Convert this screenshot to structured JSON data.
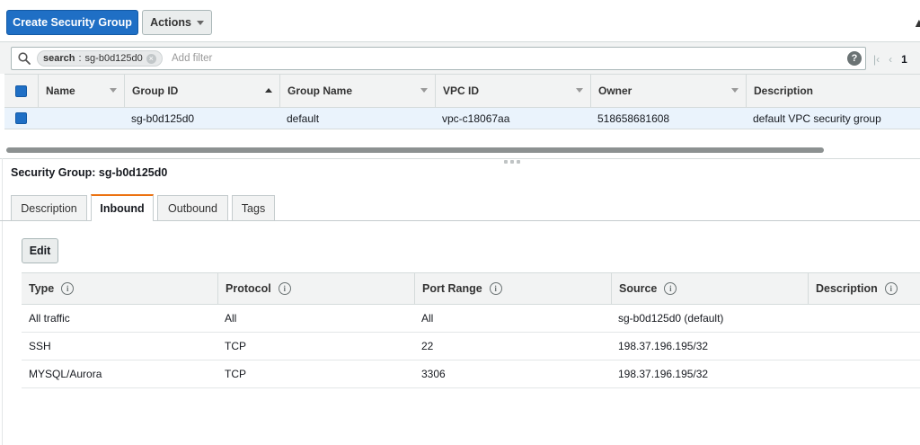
{
  "toolbar": {
    "create_label": "Create Security Group",
    "actions_label": "Actions"
  },
  "filter": {
    "chip_key": "search",
    "chip_value": "sg-b0d125d0",
    "placeholder": "Add filter",
    "help": "?",
    "page_count": "1"
  },
  "grid": {
    "headers": {
      "name": "Name",
      "group_id": "Group ID",
      "group_name": "Group Name",
      "vpc_id": "VPC ID",
      "owner": "Owner",
      "description": "Description"
    },
    "rows": [
      {
        "name": "",
        "group_id": "sg-b0d125d0",
        "group_name": "default",
        "vpc_id": "vpc-c18067aa",
        "owner": "518658681608",
        "description": "default VPC security group"
      }
    ]
  },
  "detail": {
    "title": "Security Group: sg-b0d125d0",
    "tabs": [
      {
        "label": "Description"
      },
      {
        "label": "Inbound"
      },
      {
        "label": "Outbound"
      },
      {
        "label": "Tags"
      }
    ],
    "active_tab": "Inbound",
    "edit_label": "Edit"
  },
  "rules": {
    "headers": {
      "type": "Type",
      "protocol": "Protocol",
      "port_range": "Port Range",
      "source": "Source",
      "description": "Description"
    },
    "rows": [
      {
        "type": "All traffic",
        "protocol": "All",
        "port_range": "All",
        "source": "sg-b0d125d0 (default)",
        "description": ""
      },
      {
        "type": "SSH",
        "protocol": "TCP",
        "port_range": "22",
        "source": "198.37.196.195/32",
        "description": ""
      },
      {
        "type": "MYSQL/Aurora",
        "protocol": "TCP",
        "port_range": "3306",
        "source": "198.37.196.195/32",
        "description": ""
      }
    ]
  },
  "colors": {
    "primary": "#1f6fc5",
    "active_tab_accent": "#ec7211",
    "selected_row": "#eaf3fc"
  }
}
